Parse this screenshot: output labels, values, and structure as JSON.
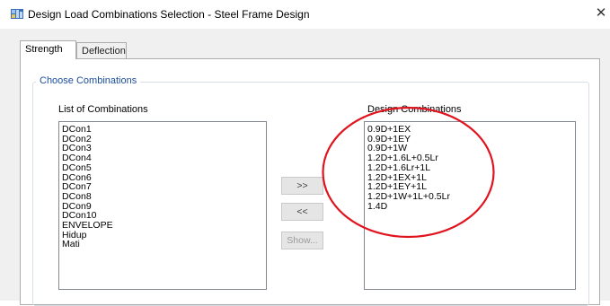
{
  "window": {
    "title": "Design Load Combinations Selection - Steel Frame Design",
    "close_glyph": "✕"
  },
  "tabs": [
    {
      "label": "Strength",
      "active": true
    },
    {
      "label": "Deflection",
      "active": false
    }
  ],
  "group": {
    "title": "Choose Combinations"
  },
  "list_of_combinations": {
    "label": "List of Combinations",
    "items": [
      "DCon1",
      "DCon2",
      "DCon3",
      "DCon4",
      "DCon5",
      "DCon6",
      "DCon7",
      "DCon8",
      "DCon9",
      "DCon10",
      "ENVELOPE",
      "Hidup",
      "Mati"
    ]
  },
  "design_combinations": {
    "label": "Design Combinations",
    "items": [
      "0.9D+1EX",
      "0.9D+1EY",
      "0.9D+1W",
      "1.2D+1.6L+0.5Lr",
      "1.2D+1.6Lr+1L",
      "1.2D+1EX+1L",
      "1.2D+1EY+1L",
      "1.2D+1W+1L+0.5Lr",
      "1.4D"
    ]
  },
  "buttons": {
    "add": ">>",
    "remove": "<<",
    "show": "Show..."
  },
  "colors": {
    "annotation_circle": "#e0141e",
    "group_title": "#1a4e9c"
  },
  "icons": {
    "app": "etabs-app-icon",
    "close": "close-icon"
  }
}
